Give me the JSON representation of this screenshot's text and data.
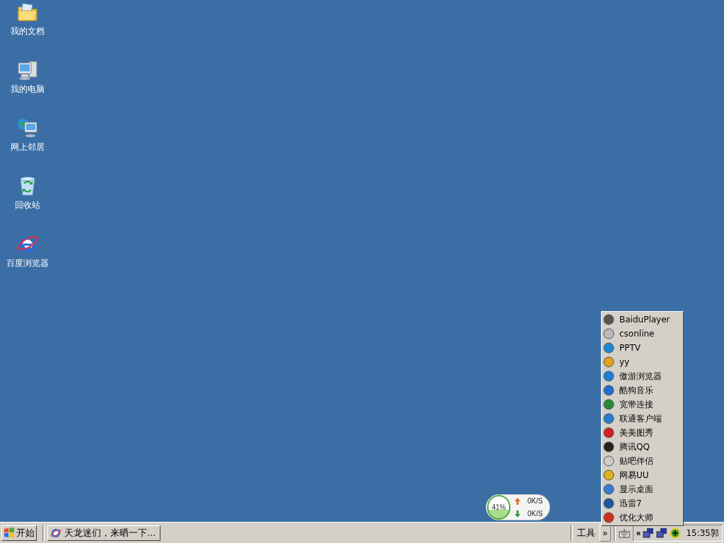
{
  "desktop_icons": [
    {
      "label": "我的文档",
      "kind": "folder"
    },
    {
      "label": "我的电脑",
      "kind": "computer"
    },
    {
      "label": "网上邻居",
      "kind": "network"
    },
    {
      "label": "回收站",
      "kind": "recycle"
    },
    {
      "label": "百度浏览器",
      "kind": "browser"
    }
  ],
  "popup_menu": {
    "items": [
      {
        "label": "BaiduPlayer",
        "color": "#555555"
      },
      {
        "label": "csonline",
        "color": "#bbbbbb"
      },
      {
        "label": "PPTV",
        "color": "#1e88d0"
      },
      {
        "label": "yy",
        "color": "#e0a020"
      },
      {
        "label": "傲游浏览器",
        "color": "#1a7fd6"
      },
      {
        "label": "酷狗音乐",
        "color": "#1a6fd0"
      },
      {
        "label": "宽带连接",
        "color": "#2a8a3a"
      },
      {
        "label": "联通客户端",
        "color": "#2a7ad0"
      },
      {
        "label": "美美图秀",
        "color": "#d02020"
      },
      {
        "label": "腾讯QQ",
        "color": "#222222"
      },
      {
        "label": "贴吧伴侣",
        "color": "#cccccc"
      },
      {
        "label": "网易UU",
        "color": "#e0b020"
      },
      {
        "label": "显示桌面",
        "color": "#3a7ad0"
      },
      {
        "label": "迅雷7",
        "color": "#1a5aa0"
      },
      {
        "label": "优化大师",
        "color": "#d03020"
      }
    ]
  },
  "network_widget": {
    "percent": "41%",
    "level": 0.41,
    "upload": "0K/S",
    "download": "0K/S"
  },
  "taskbar": {
    "start_label": "开始",
    "tasks": [
      {
        "label": "天龙迷们，来晒一下...",
        "selected": false
      }
    ],
    "toolbar_label": "工具",
    "toolbar_chevron": "»",
    "tray_chevron": "«",
    "clock": "15:35郭"
  }
}
